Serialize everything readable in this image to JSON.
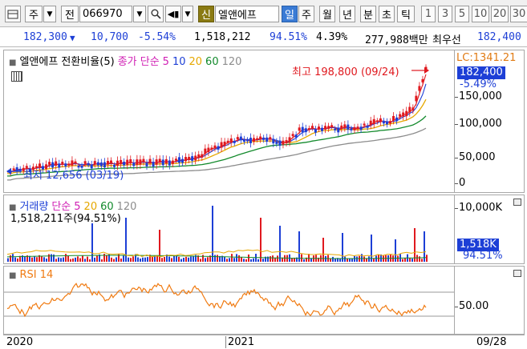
{
  "toolbar": {
    "period": "주",
    "prefix": "전",
    "code": "066970",
    "sin": "신",
    "name": "엘앤에프",
    "periods": [
      "일",
      "주",
      "월",
      "년",
      "분",
      "초",
      "틱"
    ],
    "numbers": [
      "1",
      "3",
      "5",
      "10",
      "20",
      "30"
    ]
  },
  "quote": {
    "price": "182,300",
    "arrow": "▼",
    "change": "10,700",
    "change_pct": "-5.54%",
    "volume": "1,518,212",
    "vol_ratio": "94.51%",
    "turnover": "4.39%",
    "amount": "277,988백만",
    "label": "최우선",
    "best": "182,400"
  },
  "price_pane": {
    "title": "엘앤에프 전환비율(5)",
    "ma_label": "종가 단순",
    "ma_periods": [
      "5",
      "10",
      "20",
      "60",
      "120"
    ],
    "high_label": "최고 198,800 (09/24)",
    "low_label": "최저 12,656 (03/19)",
    "lc_label": "LC:1341.21",
    "price_tag": "182,400",
    "pct_tag": "-5.49%",
    "ticks": [
      "150,000",
      "100,000",
      "50,000",
      "0"
    ]
  },
  "volume_pane": {
    "title": "거래량",
    "ma_label": "단순",
    "ma_periods": [
      "5",
      "20",
      "60",
      "120"
    ],
    "sub": "1,518,211주(94.51%)",
    "tick": "10,000K",
    "tag": "1,518K",
    "tag_pct": "94.51%"
  },
  "rsi_pane": {
    "title": "RSI 14",
    "tick": "50.00"
  },
  "x_axis": {
    "labels": [
      "2020",
      "2021"
    ],
    "cursor_date": "09/28"
  },
  "colors": {
    "accent_blue": "#1d3fd6",
    "up_red": "#e0191f",
    "ma5": "#e0191f",
    "ma10": "#1d3fd6",
    "ma20": "#e6a800",
    "ma60": "#138a2c",
    "ma120": "#8c8c8c",
    "rsi": "#f07b12"
  }
}
